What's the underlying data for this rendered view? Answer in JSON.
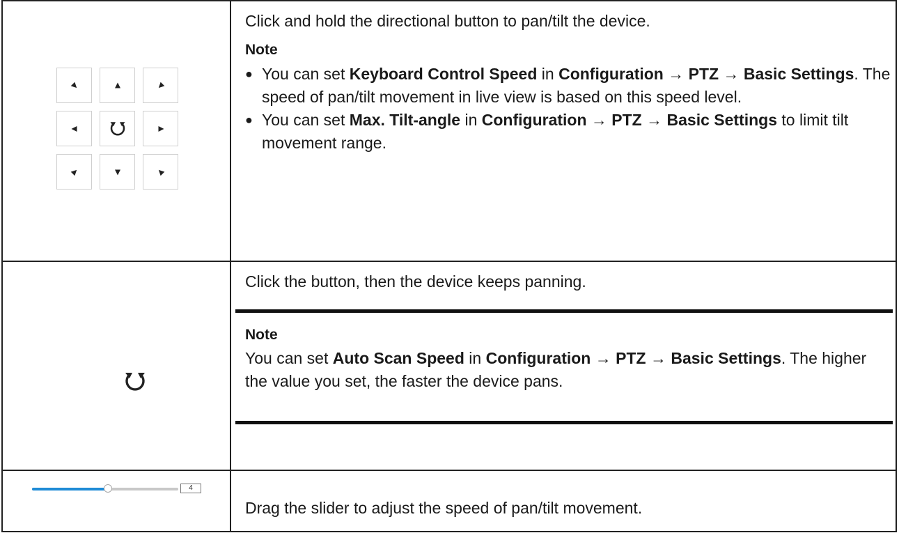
{
  "rows": [
    {
      "description": "Click and hold the directional button to pan/tilt the device.",
      "note_title": "Note",
      "notes": [
        {
          "bullet": "●",
          "parts": [
            {
              "t": "You can set ",
              "b": false
            },
            {
              "t": "Keyboard Control Speed",
              "b": true
            },
            {
              "t": " in ",
              "b": false
            },
            {
              "t": "Configuration",
              "b": true
            },
            {
              "t": " → ",
              "b": false
            },
            {
              "t": "PTZ",
              "b": true
            },
            {
              "t": " → ",
              "b": false
            },
            {
              "t": "Basic Settings",
              "b": true
            },
            {
              "t": ". The speed of pan/tilt movement in live view is based on this speed level.",
              "b": false
            }
          ]
        },
        {
          "bullet": "●",
          "parts": [
            {
              "t": "You can set ",
              "b": false
            },
            {
              "t": "Max. Tilt-angle",
              "b": true
            },
            {
              "t": " in ",
              "b": false
            },
            {
              "t": "Configuration",
              "b": true
            },
            {
              "t": " → ",
              "b": false
            },
            {
              "t": "PTZ",
              "b": true
            },
            {
              "t": " → ",
              "b": false
            },
            {
              "t": "Basic Settings",
              "b": true
            },
            {
              "t": " to limit tilt movement range.",
              "b": false
            }
          ]
        }
      ],
      "pad_buttons": [
        "up-left",
        "up",
        "up-right",
        "left",
        "auto-scan",
        "right",
        "down-left",
        "down",
        "down-right"
      ]
    },
    {
      "description": "Click the button, then the device keeps panning.",
      "note_title": "Note",
      "note_parts": [
        {
          "t": "You can set ",
          "b": false
        },
        {
          "t": "Auto Scan Speed",
          "b": true
        },
        {
          "t": " in ",
          "b": false
        },
        {
          "t": "Configuration",
          "b": true
        },
        {
          "t": " → ",
          "b": false
        },
        {
          "t": "PTZ",
          "b": true
        },
        {
          "t": " → ",
          "b": false
        },
        {
          "t": "Basic Settings",
          "b": true
        },
        {
          "t": ". The higher the value you set, the faster the device pans.",
          "b": false
        }
      ],
      "icon": "auto-scan-icon"
    },
    {
      "description": "Drag the slider to adjust the speed of pan/tilt movement.",
      "slider": {
        "value": "4",
        "fraction": 0.5,
        "fill_color": "#1f8bd6"
      }
    }
  ]
}
